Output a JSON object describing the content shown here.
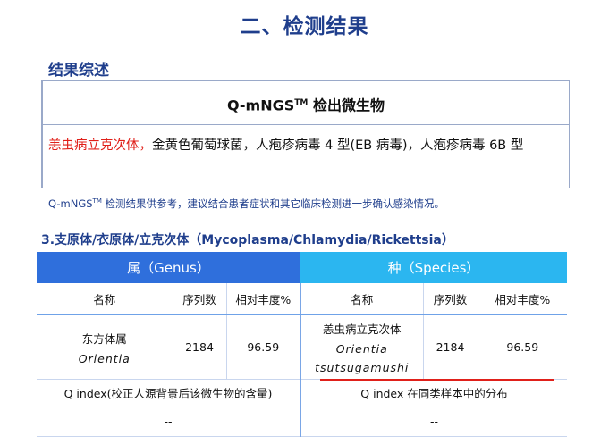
{
  "section_title": "二、检测结果",
  "summary": {
    "heading": "结果综述",
    "box_title_prefix": "Q-mNGS",
    "box_title_tm": "TM",
    "box_title_suffix": " 检出微生物",
    "highlight": "恙虫病立克次体，",
    "rest": "金黄色葡萄球菌，人疱疹病毒 4 型(EB 病毒)，人疱疹病毒 6B 型"
  },
  "note": {
    "prefix": "Q-mNGS",
    "tm": "TM",
    "text": " 检测结果供参考，建议结合患者症状和其它临床检测进一步确认感染情况。"
  },
  "table_section": {
    "title": "3.支原体/衣原体/立克次体（Mycoplasma/Chlamydia/Rickettsia）",
    "genus_header": "属（Genus）",
    "species_header": "种（Species）",
    "columns": [
      "名称",
      "序列数",
      "相对丰度%"
    ],
    "genus_row": {
      "name_cn": "东方体属",
      "name_latin": "Orientia",
      "reads": "2184",
      "abundance": "96.59"
    },
    "species_row": {
      "name_cn": "恙虫病立克次体",
      "name_latin_1": "Orientia",
      "name_latin_2": "tsutsugamushi",
      "reads": "2184",
      "abundance": "96.59"
    },
    "q_index_left": "Q index(校正人源背景后该微生物的含量)",
    "q_index_right": "Q index 在同类样本中的分布",
    "dash_left": "--",
    "dash_right": "--"
  }
}
